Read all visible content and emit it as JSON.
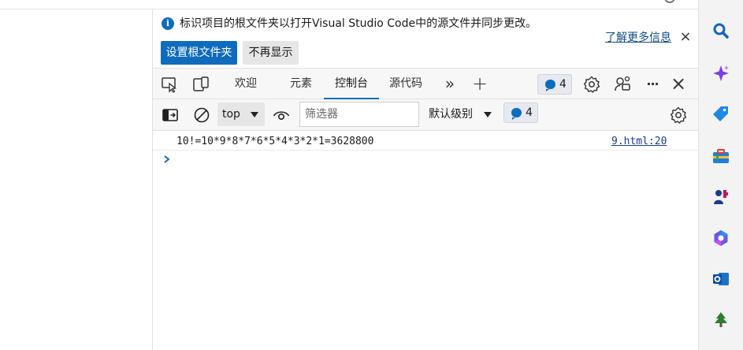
{
  "banner": {
    "message": "标识项目的根文件夹以打开Visual Studio Code中的源文件并同步更改。",
    "primary_button": "设置根文件夹",
    "secondary_button": "不再显示",
    "learn_more": "了解更多信息",
    "close": "×"
  },
  "tabs": [
    {
      "label": "欢迎",
      "active": false
    },
    {
      "label": "元素",
      "active": false
    },
    {
      "label": "控制台",
      "active": true
    },
    {
      "label": "源代码",
      "active": false
    }
  ],
  "tabbar": {
    "more_tabs": "»",
    "add_tab": "+",
    "issues_count": "4",
    "more_options": "···",
    "close": "×"
  },
  "console_toolbar": {
    "context": "top",
    "filter_placeholder": "筛选器",
    "level": "默认级别",
    "issues_count": "4"
  },
  "console": {
    "messages": [
      {
        "text": "10!=10*9*8*7*6*5*4*3*2*1=3628800",
        "source": "9.html:20"
      }
    ]
  },
  "colors": {
    "accent": "#0f6cbd",
    "toolbar_bg": "#f7f7f7",
    "sidebar_bg": "#f3f3f3"
  },
  "sidebar_icons": [
    "search-icon",
    "copilot-icon",
    "shopping-tag-icon",
    "tools-icon",
    "games-icon",
    "microsoft365-icon",
    "outlook-icon",
    "tree-icon"
  ]
}
